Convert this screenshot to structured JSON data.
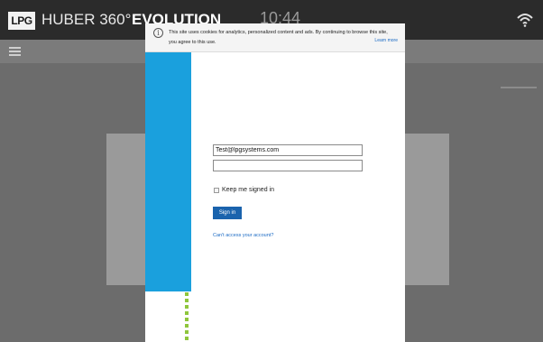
{
  "app_bar": {
    "logo_text": "LPG",
    "title_regular": "HUBER 360°",
    "title_bold": "EVOLUTION",
    "time": "10:44"
  },
  "cookie_banner": {
    "message": "This site uses cookies for analytics, personalized content and ads. By continuing to browse this site, you agree to this use.",
    "learn_more": "Learn more"
  },
  "login": {
    "email_value": "Test@lpgsystems.com",
    "password_value": "",
    "keep_signed_in": "Keep me signed in",
    "sign_in_button": "Sign in",
    "cant_access": "Can't access your account?"
  },
  "icons": {
    "info": "info-icon",
    "wifi": "wifi-icon",
    "menu": "menu-icon"
  },
  "colors": {
    "brand_blue": "#1aa0dd",
    "button_blue": "#1a63ad",
    "link_blue": "#1a6ac4",
    "progress_green": "#8fc63c"
  }
}
